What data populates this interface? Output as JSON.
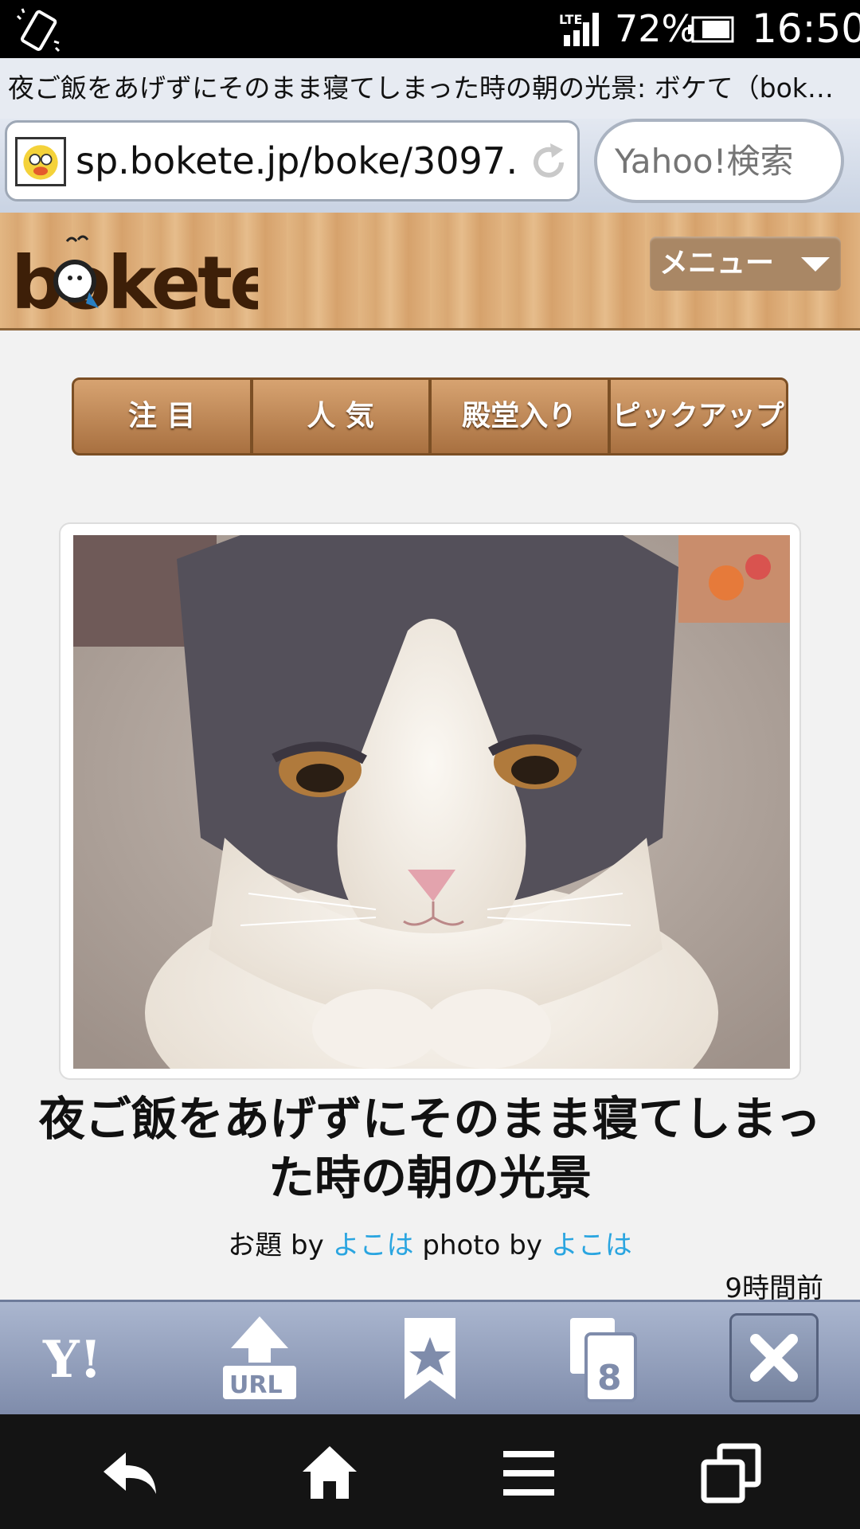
{
  "status_bar": {
    "network": "LTE",
    "battery": "72%",
    "time": "16:50"
  },
  "browser": {
    "tab_title": "夜ご飯をあげずにそのまま寝てしまった時の朝の光景: ボケて（bok…",
    "url": "sp.bokete.jp/boke/3097…",
    "search_placeholder": "Yahoo!検索",
    "tab_count": "8"
  },
  "site": {
    "logo": "bokete",
    "menu_label": "メニュー"
  },
  "category_tabs": [
    "注 目",
    "人 気",
    "殿堂入り",
    "ピックアップ"
  ],
  "post": {
    "caption": "夜ご飯をあげずにそのまま寝てしまった時の朝の光景",
    "theme_prefix": "お題 by ",
    "theme_author": "よこは",
    "photo_prefix": " photo by ",
    "photo_author": "よこは",
    "time_ago": "9時間前"
  },
  "colors": {
    "link": "#2aa5e0",
    "wood": "#d9a873",
    "toolbar": "#8f9bb8"
  }
}
